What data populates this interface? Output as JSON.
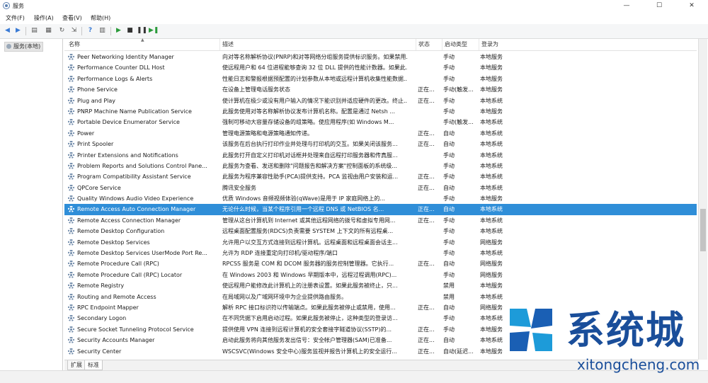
{
  "window": {
    "title": "服务",
    "minimize": "—",
    "maximize": "☐",
    "close": "✕"
  },
  "menu": [
    "文件(F)",
    "操作(A)",
    "查看(V)",
    "帮助(H)"
  ],
  "tree": {
    "item": "服务(本地)"
  },
  "columns": {
    "name": "名称",
    "description": "描述",
    "status": "状态",
    "startup": "启动类型",
    "logon": "登录为"
  },
  "services": [
    {
      "name": "Peer Networking Identity Manager",
      "description": "向对等名称解析协议(PNRP)和对等网络分组服务提供标识服务。如果禁用...",
      "status": "",
      "startup": "手动",
      "logon": "本地服务"
    },
    {
      "name": "Performance Counter DLL Host",
      "description": "使远程用户和 64 位进程能够查询 32 位 DLL 提供的性能计数器。如果此...",
      "status": "",
      "startup": "手动",
      "logon": "本地服务"
    },
    {
      "name": "Performance Logs & Alerts",
      "description": "性能日志和警报根据预配置的计划参数从本地或远程计算机收集性能数据...",
      "status": "",
      "startup": "手动",
      "logon": "本地服务"
    },
    {
      "name": "Phone Service",
      "description": "在设备上管理电话服务状态",
      "status": "正在...",
      "startup": "手动(触发...",
      "logon": "本地服务"
    },
    {
      "name": "Plug and Play",
      "description": "使计算机在极少或没有用户输入的情况下能识别并适应硬件的更改。终止...",
      "status": "正在...",
      "startup": "手动",
      "logon": "本地系统"
    },
    {
      "name": "PNRP Machine Name Publication Service",
      "description": "此服务使用对等名称解析协议发布计算机名称。配置是通过 Netsh ...",
      "status": "",
      "startup": "手动",
      "logon": "本地服务"
    },
    {
      "name": "Portable Device Enumerator Service",
      "description": "强制可移动大容量存储设备的组策略。使应用程序(如 Windows M...",
      "status": "",
      "startup": "手动(触发...",
      "logon": "本地系统"
    },
    {
      "name": "Power",
      "description": "管理电源策略和电源策略通知传递。",
      "status": "正在...",
      "startup": "自动",
      "logon": "本地系统"
    },
    {
      "name": "Print Spooler",
      "description": "该服务在后台执行打印作业并处理与打印机的交互。如果关闭该服务...",
      "status": "正在...",
      "startup": "自动",
      "logon": "本地系统"
    },
    {
      "name": "Printer Extensions and Notifications",
      "description": "此服务打开自定义打印机对话框并处理来自远程打印服务器和传真服...",
      "status": "",
      "startup": "手动",
      "logon": "本地系统"
    },
    {
      "name": "Problem Reports and Solutions Control Pane...",
      "description": "此服务为查看、发送和删除\"问题报告和解决方案\"控制面板的系统级...",
      "status": "",
      "startup": "手动",
      "logon": "本地系统"
    },
    {
      "name": "Program Compatibility Assistant Service",
      "description": "此服务为程序兼容性助手(PCA)提供支持。PCA 监视由用户安装和运...",
      "status": "正在...",
      "startup": "手动",
      "logon": "本地系统"
    },
    {
      "name": "QPCore Service",
      "description": "腾讯安全服务",
      "status": "正在...",
      "startup": "自动",
      "logon": "本地系统"
    },
    {
      "name": "Quality Windows Audio Video Experience",
      "description": "优质 Windows 音频视频体验(qWave)是用于 IP 家庭网络上的...",
      "status": "",
      "startup": "手动",
      "logon": "本地服务"
    },
    {
      "name": "Remote Access Auto Connection Manager",
      "description": "无论什么时候，当某个程序引用一个远程 DNS 或 NetBIOS 名...",
      "status": "正在...",
      "startup": "自动",
      "logon": "本地系统"
    },
    {
      "name": "Remote Access Connection Manager",
      "description": "管理从这台计算机到 Internet 或其他远程网络的拨号和虚拟专用网...",
      "status": "正在...",
      "startup": "手动",
      "logon": "本地系统"
    },
    {
      "name": "Remote Desktop Configuration",
      "description": "远程桌面配置服务(RDCS)负责需要 SYSTEM 上下文的所有远程桌...",
      "status": "",
      "startup": "手动",
      "logon": "本地系统"
    },
    {
      "name": "Remote Desktop Services",
      "description": "允许用户以交互方式连接到远程计算机。远程桌面和远程桌面会话主...",
      "status": "",
      "startup": "手动",
      "logon": "网络服务"
    },
    {
      "name": "Remote Desktop Services UserMode Port Re...",
      "description": "允许为 RDP 连接重定向打印机/驱动程序/端口",
      "status": "",
      "startup": "手动",
      "logon": "本地系统"
    },
    {
      "name": "Remote Procedure Call (RPC)",
      "description": "RPCSS 服务是 COM 和 DCOM 服务器的服务控制管理器。它执行...",
      "status": "正在...",
      "startup": "自动",
      "logon": "网络服务"
    },
    {
      "name": "Remote Procedure Call (RPC) Locator",
      "description": "在 Windows 2003 和 Windows 早期版本中，远程过程调用(RPC)...",
      "status": "",
      "startup": "手动",
      "logon": "网络服务"
    },
    {
      "name": "Remote Registry",
      "description": "使远程用户能修改此计算机上的注册表设置。如果此服务被终止，只...",
      "status": "",
      "startup": "禁用",
      "logon": "本地服务"
    },
    {
      "name": "Routing and Remote Access",
      "description": "在局域网以及广域网环境中为企业提供路由服务。",
      "status": "",
      "startup": "禁用",
      "logon": "本地系统"
    },
    {
      "name": "RPC Endpoint Mapper",
      "description": "解析 RPC 接口标识符以传输端点。如果此服务被停止或禁用，使用...",
      "status": "正在...",
      "startup": "自动",
      "logon": "网络服务"
    },
    {
      "name": "Secondary Logon",
      "description": "在不同凭据下启用启动过程。如果此服务被停止，这种类型的登录访...",
      "status": "",
      "startup": "手动",
      "logon": "本地系统"
    },
    {
      "name": "Secure Socket Tunneling Protocol Service",
      "description": "提供使用 VPN 连接到远程计算机的安全套接字隧道协议(SSTP)的...",
      "status": "正在...",
      "startup": "手动",
      "logon": "本地服务"
    },
    {
      "name": "Security Accounts Manager",
      "description": "启动此服务将向其他服务发出信号：安全帐户管理器(SAM)已准备...",
      "status": "正在...",
      "startup": "自动",
      "logon": "本地系统"
    },
    {
      "name": "Security Center",
      "description": "WSCSVC(Windows 安全中心)服务监视并报告计算机上的安全运行...",
      "status": "正在...",
      "startup": "自动(延迟...",
      "logon": "本地服务"
    }
  ],
  "tabs": [
    "扩展",
    "标准"
  ],
  "watermark": {
    "text": "系统城",
    "url": "xitongcheng.com"
  },
  "colors": {
    "selection": "#2f8ed8",
    "brand": "#1a4e9a"
  }
}
